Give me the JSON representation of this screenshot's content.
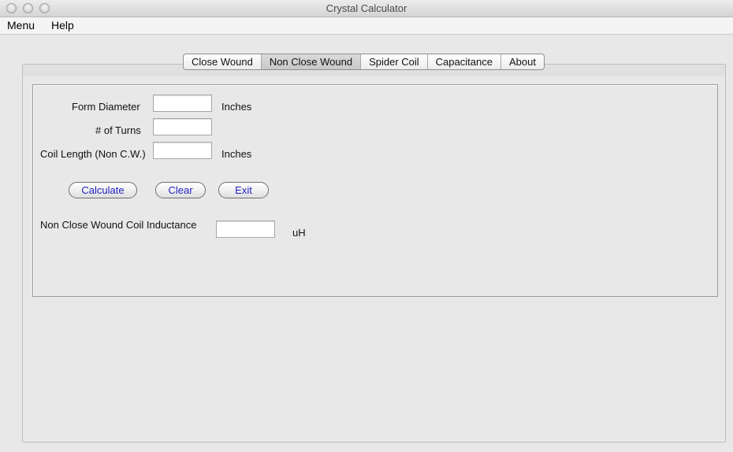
{
  "window": {
    "title": "Crystal Calculator"
  },
  "menubar": {
    "items": [
      {
        "label": "Menu"
      },
      {
        "label": "Help"
      }
    ]
  },
  "tabs": [
    {
      "label": "Close Wound",
      "selected": false
    },
    {
      "label": "Non Close Wound",
      "selected": true
    },
    {
      "label": "Spider Coil",
      "selected": false
    },
    {
      "label": "Capacitance",
      "selected": false
    },
    {
      "label": "About",
      "selected": false
    }
  ],
  "form": {
    "form_diameter": {
      "label": "Form Diameter",
      "value": "",
      "unit": "Inches"
    },
    "turns": {
      "label": "# of Turns",
      "value": ""
    },
    "coil_length": {
      "label": "Coil Length (Non C.W.)",
      "value": "",
      "unit": "Inches"
    }
  },
  "buttons": {
    "calculate": "Calculate",
    "clear": "Clear",
    "exit": "Exit"
  },
  "result": {
    "label": "Non Close Wound Coil Inductance",
    "value": "",
    "unit": "uH"
  }
}
